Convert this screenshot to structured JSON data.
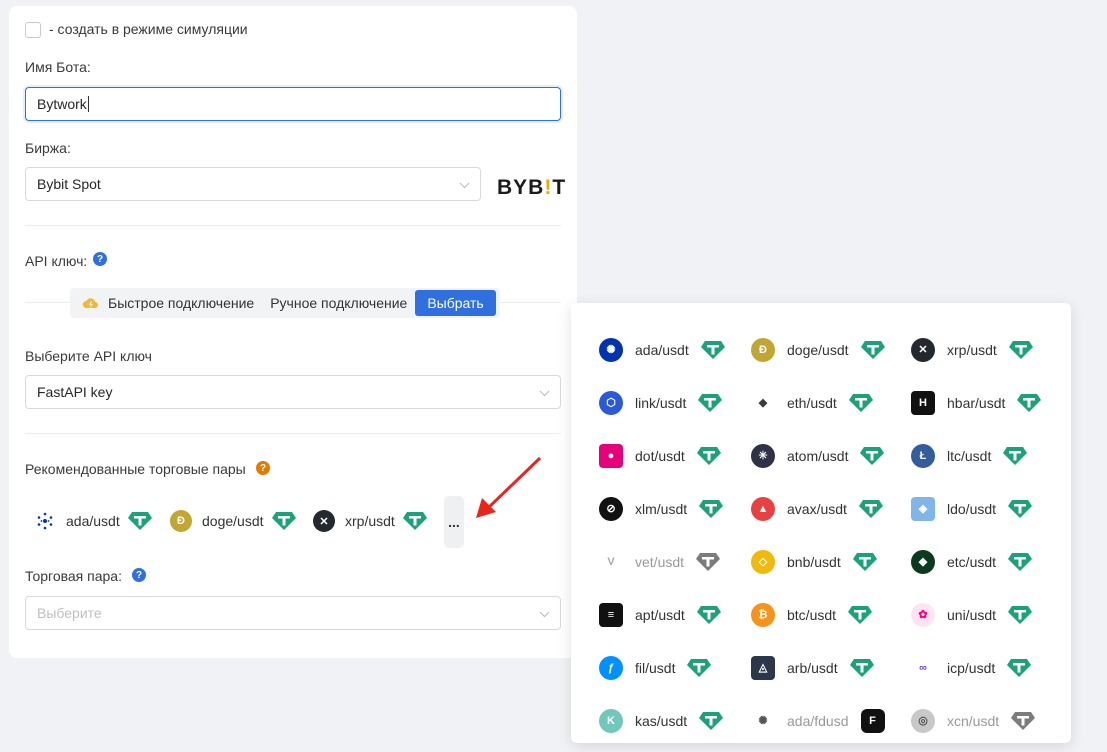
{
  "form": {
    "simulation_label": "- создать в режиме симуляции",
    "bot_name_label": "Имя Бота:",
    "bot_name_value": "Bytwork",
    "exchange_label": "Биржа:",
    "exchange_value": "Bybit Spot",
    "exchange_logo_text": "BYB",
    "exchange_logo_tail": "T",
    "api_key_label": "API ключ:",
    "api_tabs": [
      "Быстрое подключение",
      "Ручное подключение",
      "Выбрать"
    ],
    "select_api_label": "Выберите API ключ",
    "select_api_value": "FastAPI key",
    "recommended_label": "Рекомендованные торговые пары",
    "recommended": [
      "ada/usdt",
      "doge/usdt",
      "xrp/usdt"
    ],
    "more_label": "...",
    "pair_label": "Торговая пара:",
    "pair_placeholder": "Выберите"
  },
  "popup": {
    "pairs": [
      {
        "label": "ada/usdt",
        "icon": "cardano-icon",
        "color": "#0033ad",
        "glyph": "✺",
        "dim": false
      },
      {
        "label": "doge/usdt",
        "icon": "doge-icon",
        "color": "#c2a633",
        "glyph": "Ð",
        "dim": false
      },
      {
        "label": "xrp/usdt",
        "icon": "xrp-icon",
        "color": "#23292f",
        "glyph": "✕",
        "dim": false
      },
      {
        "label": "link/usdt",
        "icon": "chainlink-icon",
        "color": "#2a5ada",
        "glyph": "⬡",
        "dim": false
      },
      {
        "label": "eth/usdt",
        "icon": "ethereum-icon",
        "color": "#ffffff",
        "glyph": "◆",
        "dim": false
      },
      {
        "label": "hbar/usdt",
        "icon": "hedera-icon",
        "color": "#111111",
        "glyph": "H",
        "dim": false
      },
      {
        "label": "dot/usdt",
        "icon": "polkadot-icon",
        "color": "#e6007a",
        "glyph": "●",
        "dim": false
      },
      {
        "label": "atom/usdt",
        "icon": "cosmos-icon",
        "color": "#2e3148",
        "glyph": "✳",
        "dim": false
      },
      {
        "label": "ltc/usdt",
        "icon": "litecoin-icon",
        "color": "#345d9d",
        "glyph": "Ł",
        "dim": false
      },
      {
        "label": "xlm/usdt",
        "icon": "stellar-icon",
        "color": "#111111",
        "glyph": "⊘",
        "dim": false
      },
      {
        "label": "avax/usdt",
        "icon": "avalanche-icon",
        "color": "#e84142",
        "glyph": "▲",
        "dim": false
      },
      {
        "label": "ldo/usdt",
        "icon": "lido-icon",
        "color": "#7fb5e8",
        "glyph": "◈",
        "dim": false
      },
      {
        "label": "vet/usdt",
        "icon": "vechain-icon",
        "color": "#ffffff",
        "glyph": "V",
        "dim": true
      },
      {
        "label": "bnb/usdt",
        "icon": "bnb-icon",
        "color": "#f0b90b",
        "glyph": "◇",
        "dim": false
      },
      {
        "label": "etc/usdt",
        "icon": "ethereum-classic-icon",
        "color": "#0b3b1e",
        "glyph": "◆",
        "dim": false
      },
      {
        "label": "apt/usdt",
        "icon": "aptos-icon",
        "color": "#111111",
        "glyph": "≡",
        "dim": false
      },
      {
        "label": "btc/usdt",
        "icon": "bitcoin-icon",
        "color": "#f7931a",
        "glyph": "₿",
        "dim": false
      },
      {
        "label": "uni/usdt",
        "icon": "uniswap-icon",
        "color": "#ffe3f1",
        "glyph": "✿",
        "dim": false
      },
      {
        "label": "fil/usdt",
        "icon": "filecoin-icon",
        "color": "#0090ff",
        "glyph": "ƒ",
        "dim": false
      },
      {
        "label": "arb/usdt",
        "icon": "arbitrum-icon",
        "color": "#2d374b",
        "glyph": "◬",
        "dim": false
      },
      {
        "label": "icp/usdt",
        "icon": "icp-icon",
        "color": "#ffffff",
        "glyph": "∞",
        "dim": false
      },
      {
        "label": "kas/usdt",
        "icon": "kaspa-icon",
        "color": "#70c7ba",
        "glyph": "K",
        "dim": false
      },
      {
        "label": "ada/fdusd",
        "icon": "cardano-icon",
        "color": "#ffffff",
        "glyph": "✺",
        "dim": true
      },
      {
        "label": "xcn/usdt",
        "icon": "onyxcoin-icon",
        "color": "#c8c8c8",
        "glyph": "◎",
        "dim": true
      }
    ]
  }
}
